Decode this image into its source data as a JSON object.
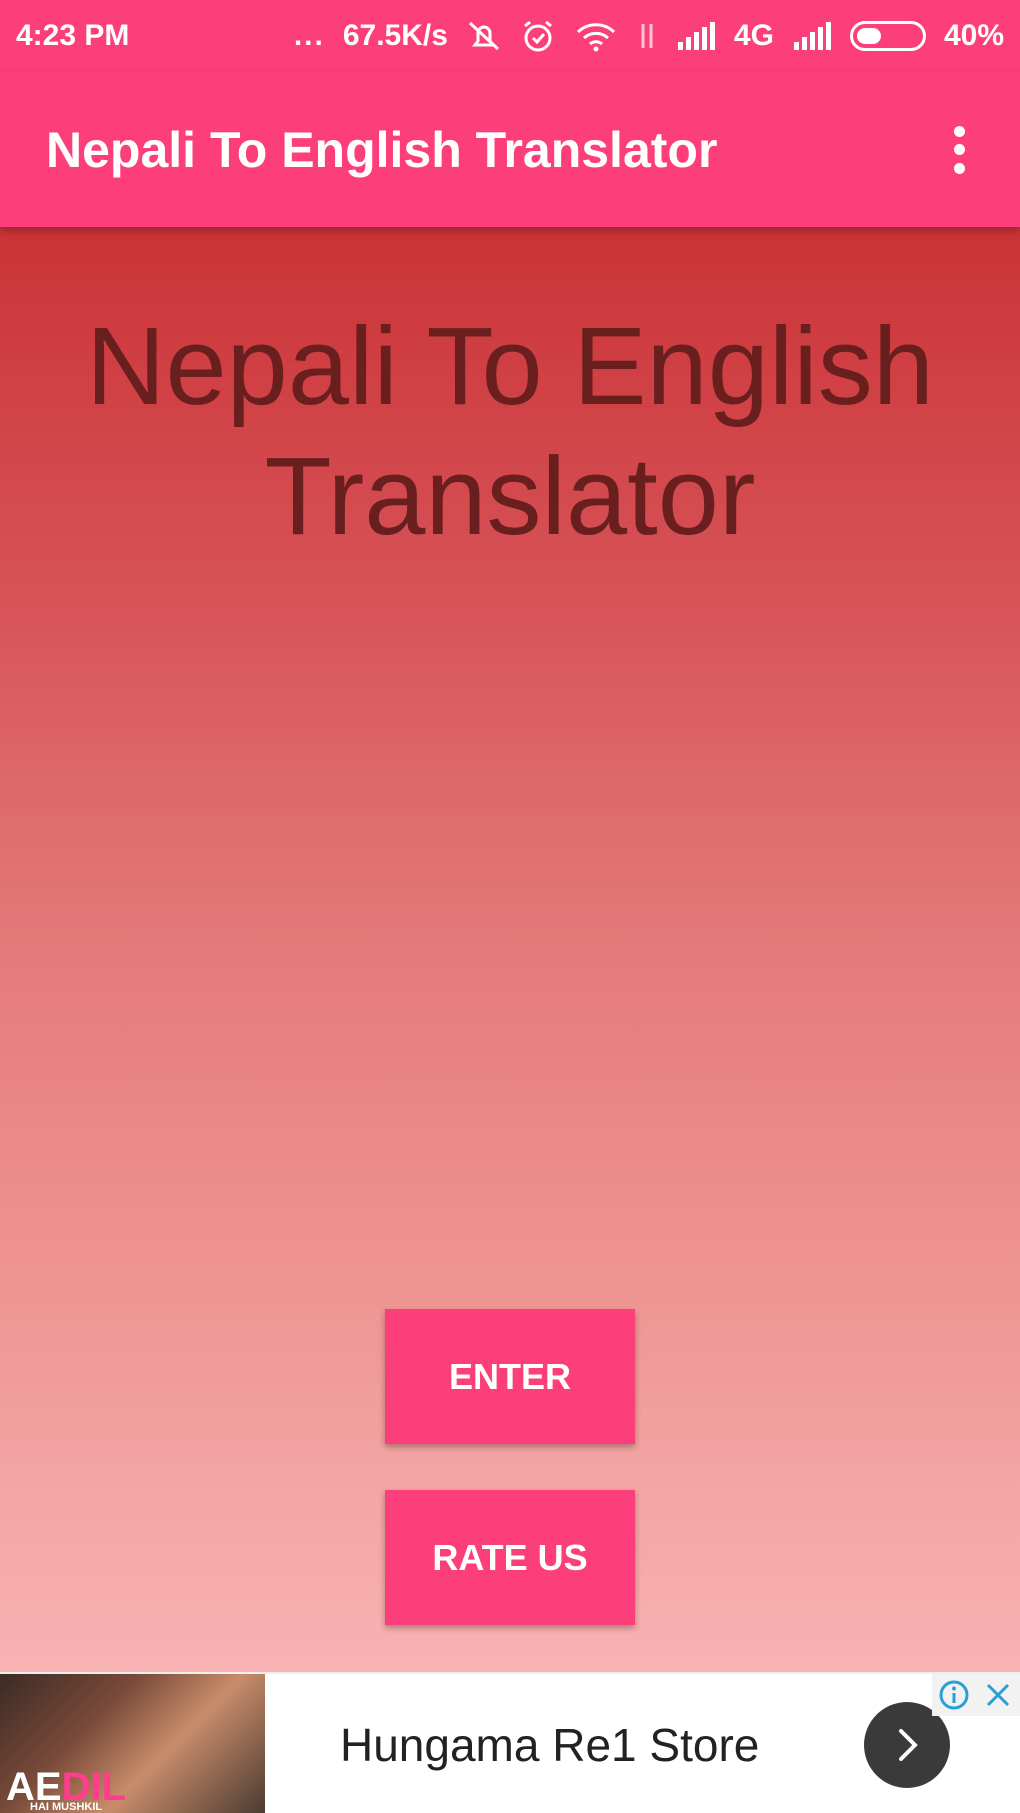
{
  "status_bar": {
    "time": "4:23 PM",
    "dots": "...",
    "speed": "67.5K/s",
    "network": "4G",
    "battery": "40%",
    "battery_level": 0.4
  },
  "app_bar": {
    "title": "Nepali To English Translator"
  },
  "main": {
    "headline_line1": "Nepali To English",
    "headline_line2": "Translator",
    "enter_label": "ENTER",
    "rate_label": "RATE US"
  },
  "ad": {
    "store_name": "Hungama Re1 Store",
    "image_logo_part1": "AE",
    "image_logo_part2": "DIL",
    "image_sub": "HAI MUSHKIL"
  },
  "colors": {
    "primary": "#fc3f7b",
    "headline": "#6a1f1f",
    "gradient_top": "#cb3336",
    "gradient_bottom": "#f8b3b3"
  }
}
